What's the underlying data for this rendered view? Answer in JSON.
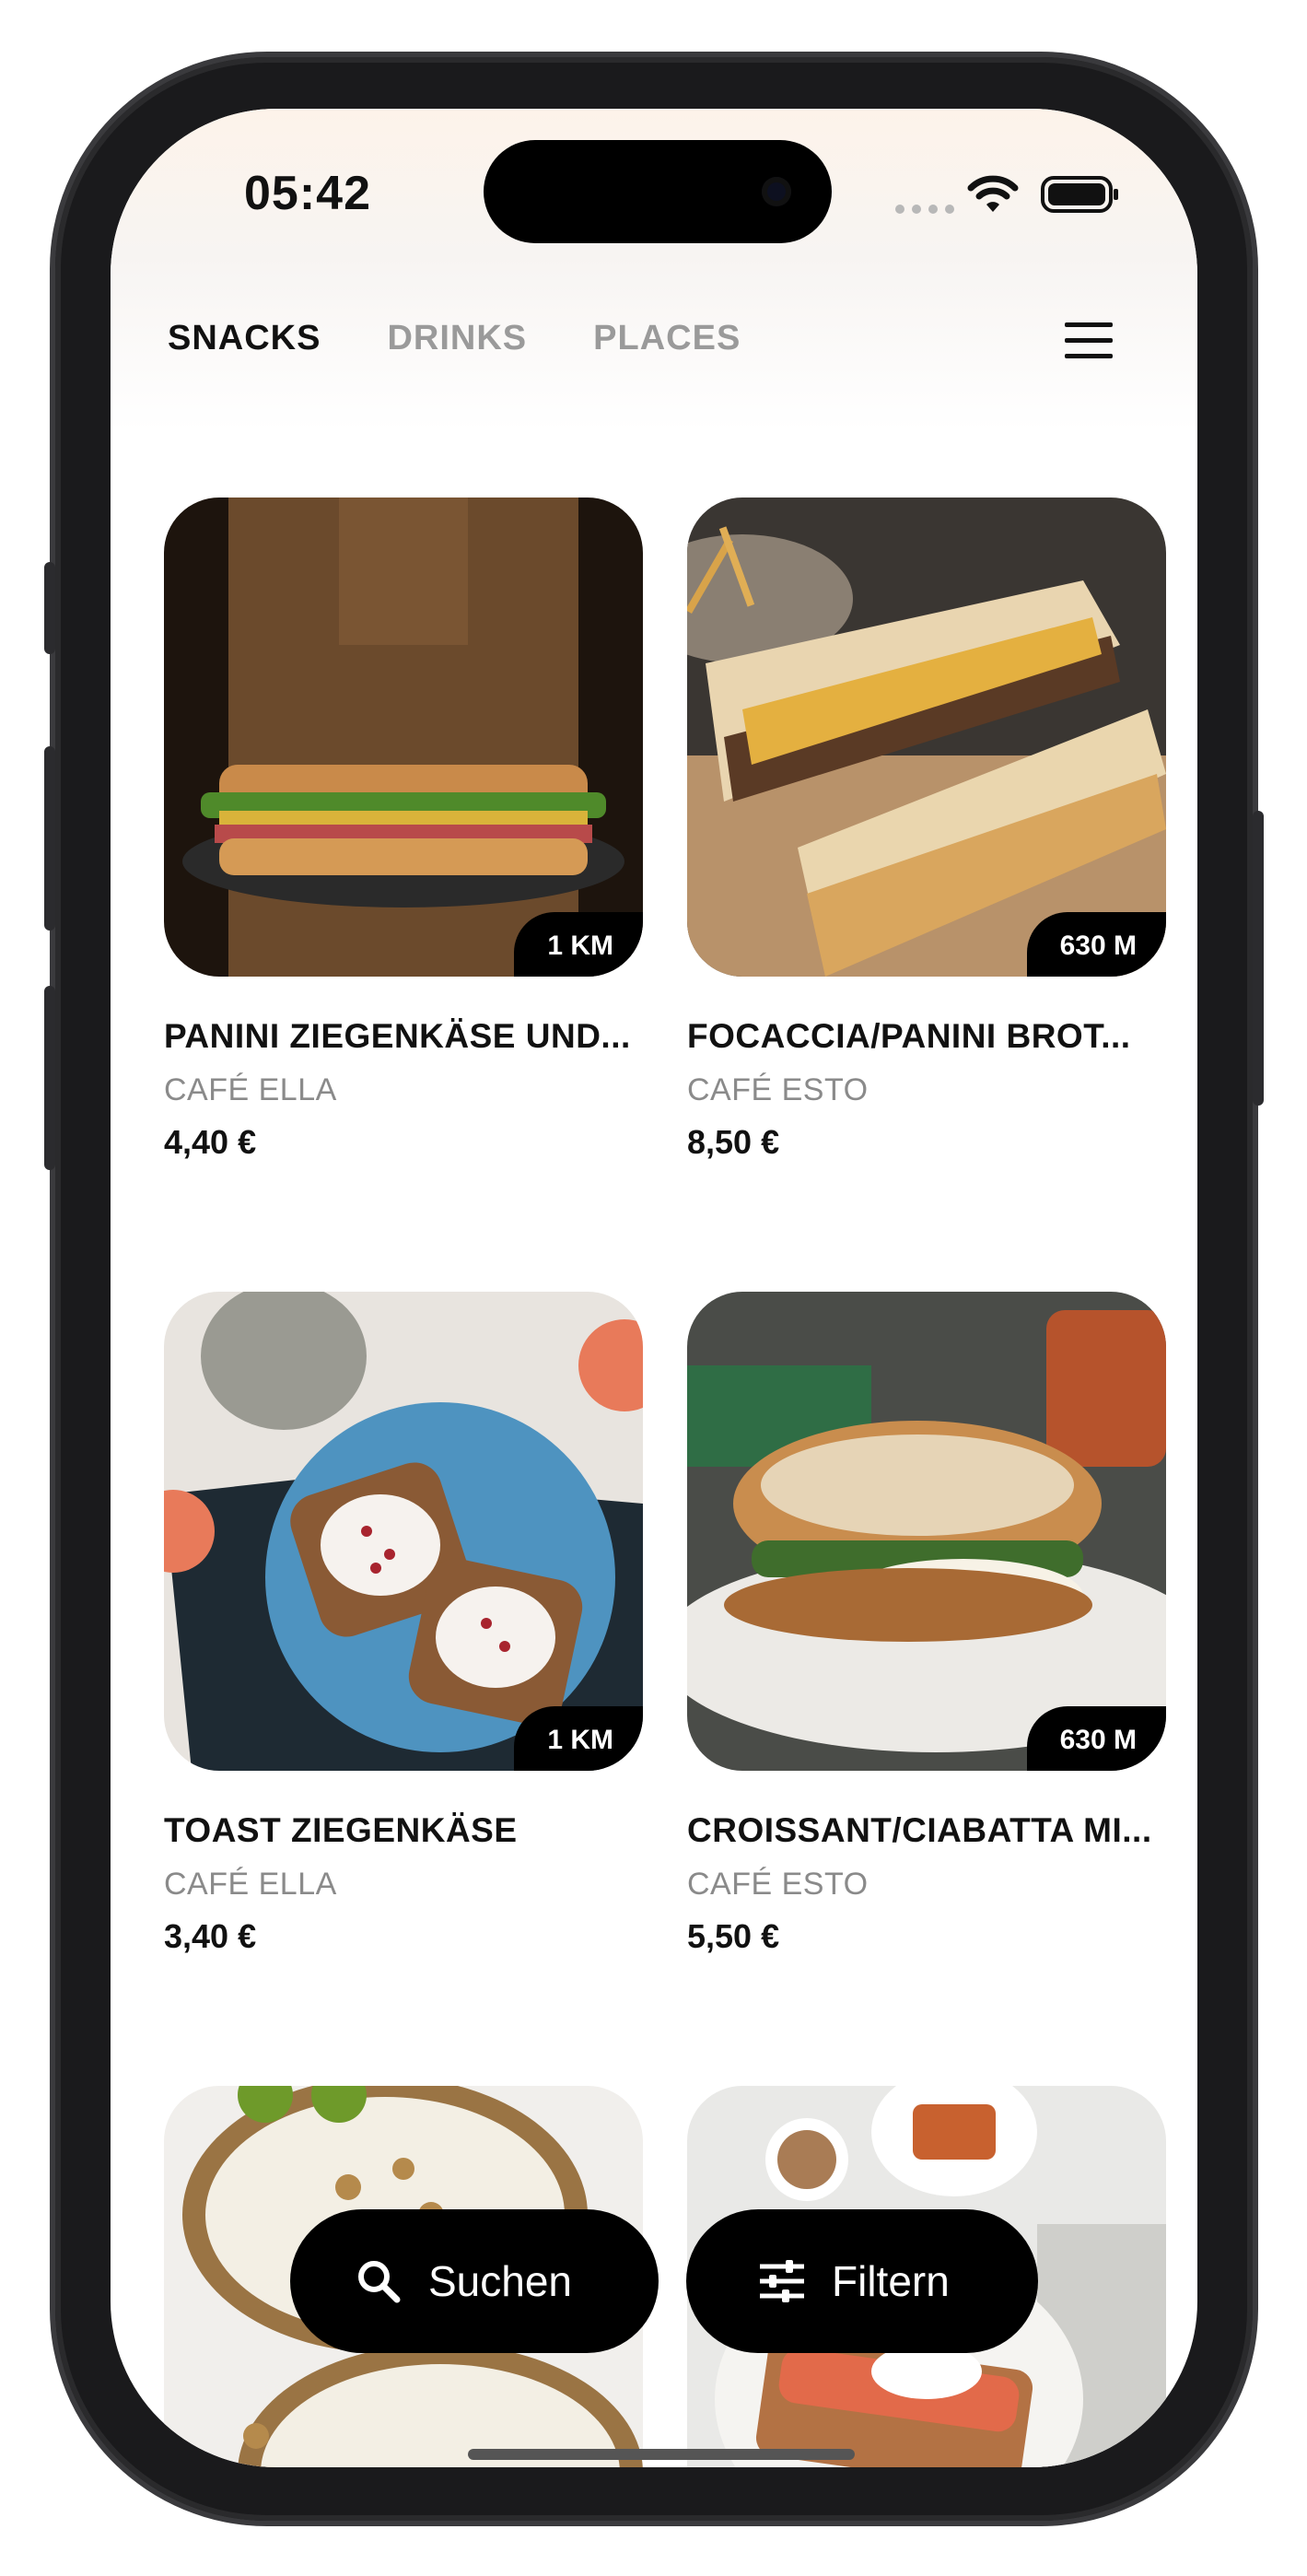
{
  "status_bar": {
    "time": "05:42"
  },
  "nav": {
    "tabs": [
      {
        "label": "SNACKS",
        "active": true
      },
      {
        "label": "DRINKS",
        "active": false
      },
      {
        "label": "PLACES",
        "active": false
      }
    ],
    "menu_icon": "hamburger-menu-icon"
  },
  "items": [
    {
      "title": "PANINI ZIEGENKÄSE UND...",
      "cafe": "CAFÉ ELLA",
      "price": "4,40 €",
      "distance": "1 KM"
    },
    {
      "title": "FOCACCIA/PANINI BROT...",
      "cafe": "CAFÉ ESTO",
      "price": "8,50 €",
      "distance": "630 M"
    },
    {
      "title": "TOAST ZIEGENKÄSE",
      "cafe": "CAFÉ ELLA",
      "price": "3,40 €",
      "distance": "1 KM"
    },
    {
      "title": "CROISSANT/CIABATTA MI...",
      "cafe": "CAFÉ ESTO",
      "price": "5,50 €",
      "distance": "630 M"
    }
  ],
  "actions": {
    "search_label": "Suchen",
    "search_icon": "search-icon",
    "filter_label": "Filtern",
    "filter_icon": "sliders-icon"
  }
}
